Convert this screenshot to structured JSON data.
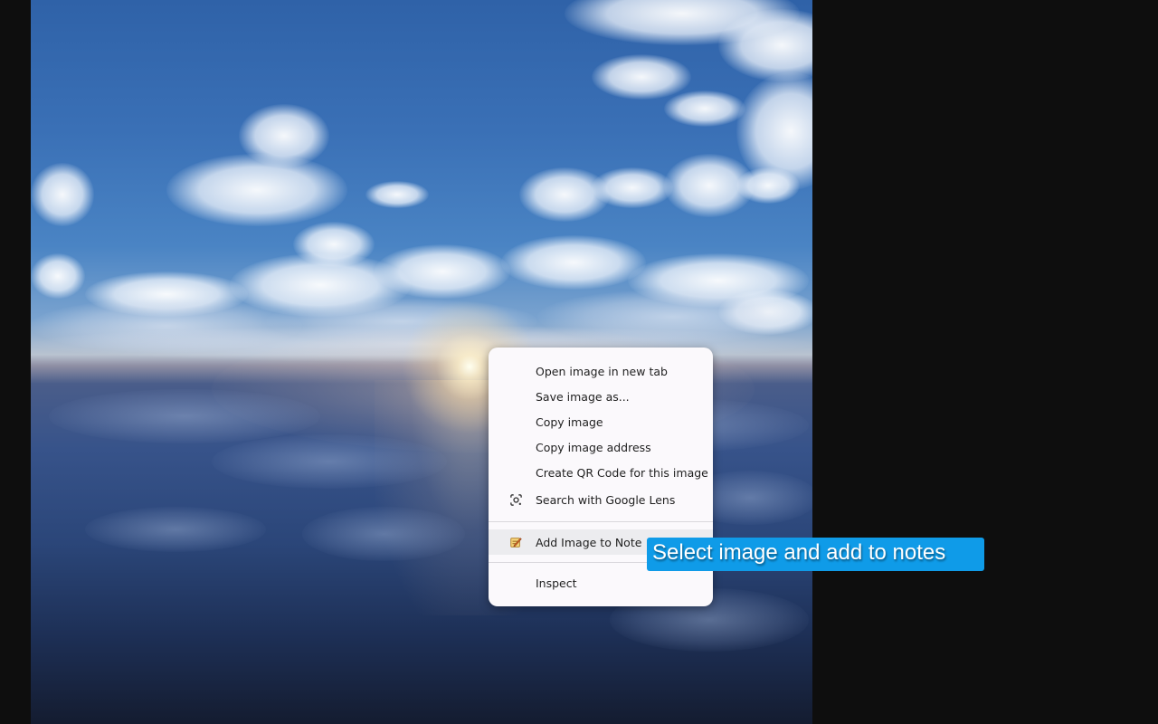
{
  "context_menu": {
    "items": [
      {
        "label": "Open image in new tab",
        "icon": ""
      },
      {
        "label": "Save image as...",
        "icon": ""
      },
      {
        "label": "Copy image",
        "icon": ""
      },
      {
        "label": "Copy image address",
        "icon": ""
      },
      {
        "label": "Create QR Code for this image",
        "icon": ""
      },
      {
        "label": "Search with Google Lens",
        "icon": "google-lens-icon"
      },
      {
        "label": "Add Image to Note",
        "icon": "note-pencil-icon"
      },
      {
        "label": "Inspect",
        "icon": ""
      }
    ]
  },
  "callout": {
    "text": "Select image and add to notes",
    "color": "#0f9be8"
  },
  "colors": {
    "background": "#0e0e0e",
    "menu_bg": "#fbf9fc",
    "menu_highlight": "#ececef"
  }
}
